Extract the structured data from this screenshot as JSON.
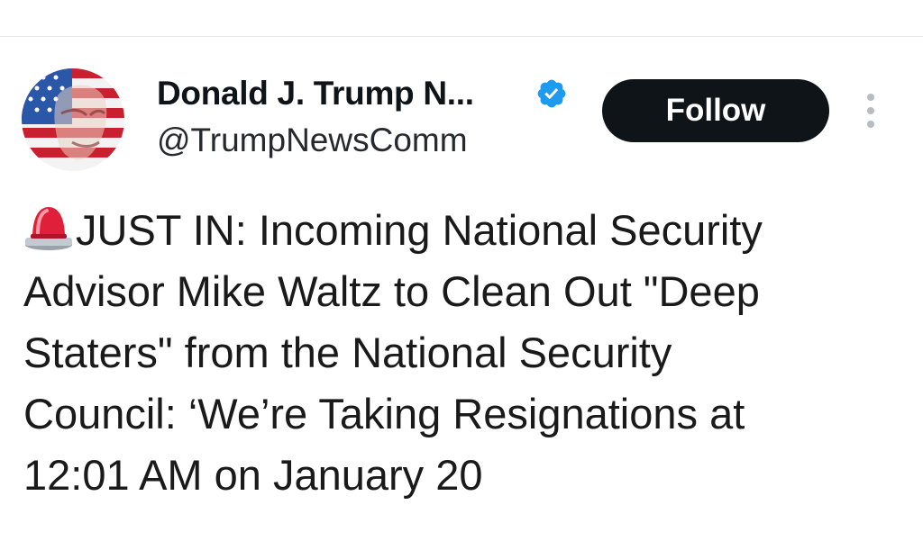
{
  "profile": {
    "display_name": "Donald J. Trump N...",
    "handle": "@TrumpNewsComm",
    "verified": true,
    "verified_color": "#1d9bf0"
  },
  "actions": {
    "follow_label": "Follow",
    "more_icon": "more-vertical-icon"
  },
  "tweet": {
    "leading_icon": "police-siren-icon",
    "text": "JUST IN: Incoming National Security\nAdvisor Mike Waltz to Clean Out \"Deep\nStaters\" from the National Security\nCouncil: ‘We’re Taking Resignations at\n12:01 AM on January 20"
  },
  "colors": {
    "follow_bg": "#0f1419",
    "follow_text": "#ffffff",
    "text": "#0f1419"
  }
}
